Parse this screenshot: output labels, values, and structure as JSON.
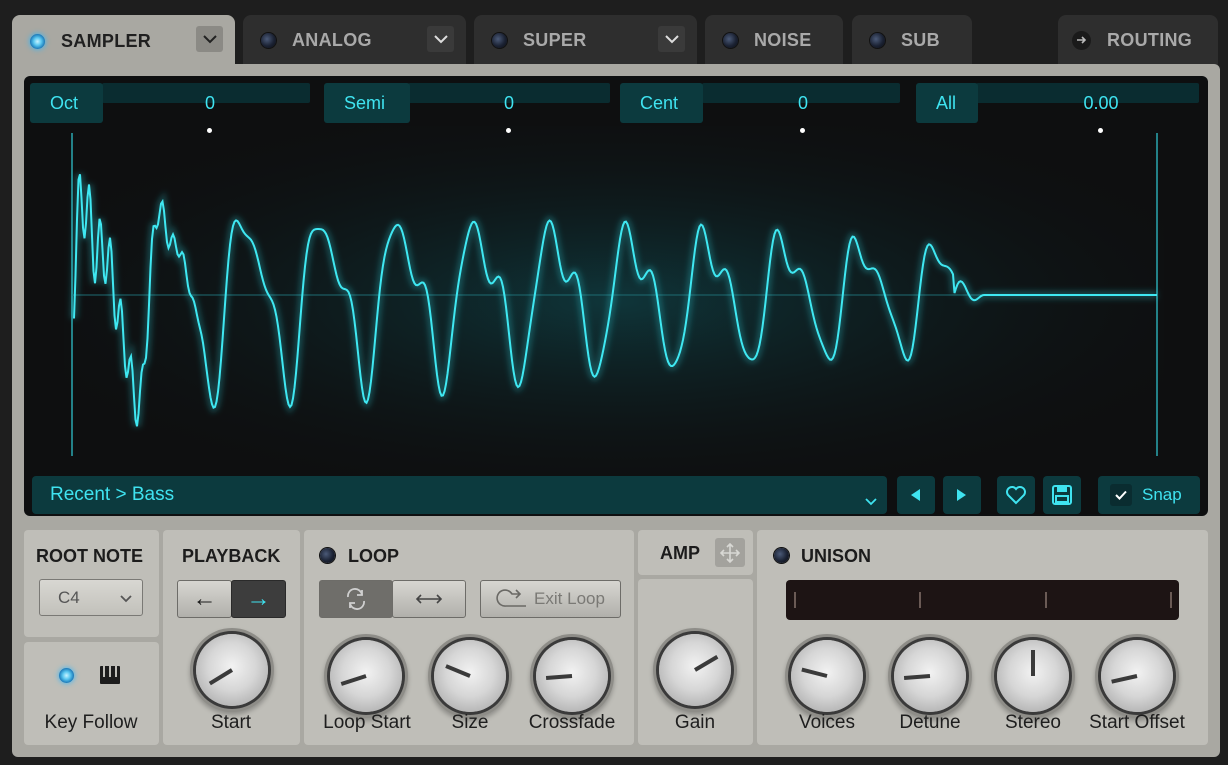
{
  "tabs": [
    {
      "label": "SAMPLER",
      "active": true,
      "led": "on",
      "dropdown": true
    },
    {
      "label": "ANALOG",
      "active": false,
      "led": "off",
      "dropdown": true
    },
    {
      "label": "SUPER",
      "active": false,
      "led": "off",
      "dropdown": true
    },
    {
      "label": "NOISE",
      "active": false,
      "led": "off",
      "dropdown": false
    },
    {
      "label": "SUB",
      "active": false,
      "led": "off",
      "dropdown": false
    },
    {
      "label": "ROUTING",
      "active": false,
      "icon": "arrow-right-icon"
    }
  ],
  "params": {
    "oct": {
      "label": "Oct",
      "value": "0"
    },
    "semi": {
      "label": "Semi",
      "value": "0"
    },
    "cent": {
      "label": "Cent",
      "value": "0"
    },
    "all": {
      "label": "All",
      "value": "0.00"
    }
  },
  "browser": {
    "path": "Recent > Bass",
    "snap_label": "Snap",
    "snap_checked": true
  },
  "root_note": {
    "title": "ROOT NOTE",
    "value": "C4"
  },
  "key_follow": {
    "label": "Key Follow",
    "enabled": true
  },
  "playback": {
    "title": "PLAYBACK",
    "reverse_icon": "←",
    "forward_icon": "→",
    "direction": "forward",
    "knob_label": "Start",
    "start_value": 0.05
  },
  "loop": {
    "title": "LOOP",
    "enabled": false,
    "exit_label": "Exit Loop",
    "knobs": [
      {
        "label": "Loop Start",
        "value": 0.1
      },
      {
        "label": "Size",
        "value": 0.25
      },
      {
        "label": "Crossfade",
        "value": 0.15
      }
    ]
  },
  "amp": {
    "title": "AMP",
    "knob_label": "Gain",
    "gain_value": 0.72
  },
  "unison": {
    "title": "UNISON",
    "enabled": false,
    "knobs": [
      {
        "label": "Voices",
        "value": 0.22
      },
      {
        "label": "Detune",
        "value": 0.15
      },
      {
        "label": "Stereo",
        "value": 0.5
      },
      {
        "label": "Start Offset",
        "value": 0.12
      }
    ]
  },
  "colors": {
    "accent": "#3fe3f0",
    "panel": "#a9a8a2",
    "display_bg": "#0e0f10"
  }
}
